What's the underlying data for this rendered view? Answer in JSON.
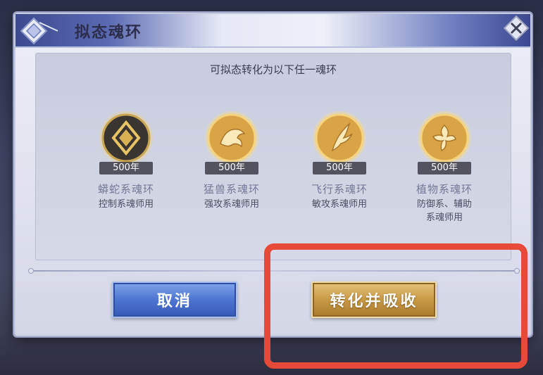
{
  "dialog": {
    "title": "拟态魂环",
    "subtitle": "可拟态转化为以下任一魂环"
  },
  "rings": [
    {
      "year": "500年",
      "name": "蟒蛇系魂环",
      "usage": "控制系魂师用",
      "icon": "shield-icon",
      "style": "dark"
    },
    {
      "year": "500年",
      "name": "猛兽系魂环",
      "usage": "强攻系魂师用",
      "icon": "beast-icon",
      "style": "gold"
    },
    {
      "year": "500年",
      "name": "飞行系魂环",
      "usage": "敏攻系魂师用",
      "icon": "feather-icon",
      "style": "gold"
    },
    {
      "year": "500年",
      "name": "植物系魂环",
      "usage": "防御系、辅助系魂师用",
      "icon": "flower-icon",
      "style": "gold"
    }
  ],
  "buttons": {
    "cancel": "取消",
    "confirm": "转化并吸收"
  },
  "colors": {
    "cancel_blue": "#4d75d2",
    "confirm_gold": "#c99a45",
    "highlight_red": "#e84a3a"
  }
}
